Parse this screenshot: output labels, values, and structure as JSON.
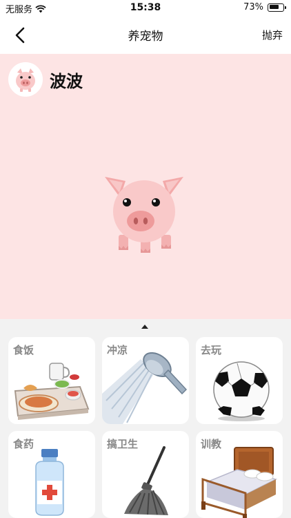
{
  "status_bar": {
    "carrier": "无服务",
    "time": "15:38",
    "battery_percent": "73%",
    "battery_level": 0.73
  },
  "nav": {
    "back_icon": "chevron-left-icon",
    "title": "养宠物",
    "action_label": "抛弃"
  },
  "pet": {
    "name": "波波",
    "type": "pig",
    "stage_color": "#fde4e4"
  },
  "panel": {
    "collapse_icon": "caret-up-icon",
    "actions": [
      {
        "label": "食饭",
        "icon": "food-tray-icon"
      },
      {
        "label": "冲凉",
        "icon": "shower-head-icon"
      },
      {
        "label": "去玩",
        "icon": "soccer-ball-icon"
      },
      {
        "label": "食药",
        "icon": "medicine-bottle-icon"
      },
      {
        "label": "搞卫生",
        "icon": "mop-icon"
      },
      {
        "label": "训教",
        "icon": "bed-icon"
      }
    ]
  },
  "colors": {
    "pig_pink": "#f5b8b8",
    "pig_snout": "#ee9b9b",
    "card_label": "#888888"
  }
}
